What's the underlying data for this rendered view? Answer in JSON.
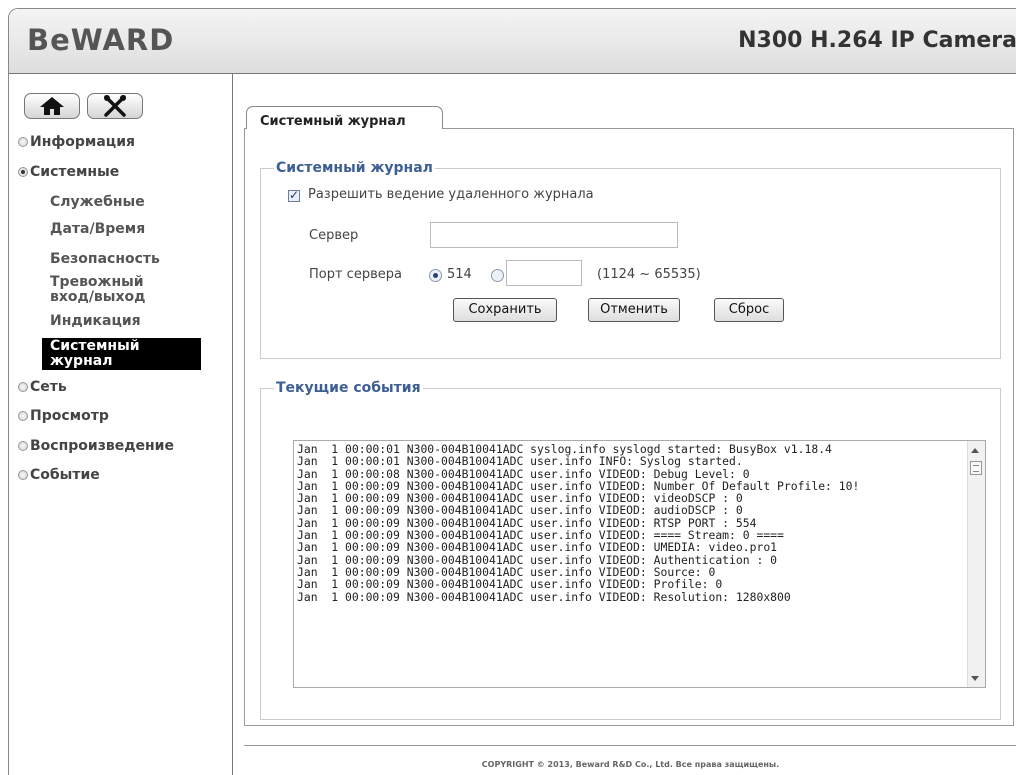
{
  "header": {
    "logo": "BeWARD",
    "model": "N300 H.264 IP Camera"
  },
  "nav_buttons": [
    {
      "icon": "home-icon"
    },
    {
      "icon": "tools-icon"
    }
  ],
  "menu": {
    "info": "Информация",
    "system": "Системные",
    "system_items": {
      "service": "Служебные",
      "datetime": "Дата/Время",
      "security": "Безопасность",
      "alarm_io_1": "Тревожный",
      "alarm_io_2": "вход/выход",
      "indication": "Индикация",
      "syslog_1": "Системный",
      "syslog_2": "журнал"
    },
    "network": "Сеть",
    "view": "Просмотр",
    "playback": "Воспроизведение",
    "event": "Событие"
  },
  "tab": {
    "label": "Системный журнал"
  },
  "syslog": {
    "legend": "Системный журнал",
    "remote_checkbox_label": "Разрешить ведение удаленного журнала",
    "remote_enabled": true,
    "server_label": "Сервер",
    "server_value": "",
    "port_label": "Порт сервера",
    "port_default": "514",
    "port_custom_value": "",
    "port_range": "(1124 ~ 65535)",
    "save": "Сохранить",
    "cancel": "Отменить",
    "reset": "Сброс"
  },
  "events": {
    "legend": "Текущие события",
    "log": "Jan  1 00:00:01 N300-004B10041ADC syslog.info syslogd started: BusyBox v1.18.4\nJan  1 00:00:01 N300-004B10041ADC user.info INFO: Syslog started.\nJan  1 00:00:08 N300-004B10041ADC user.info VIDEOD: Debug Level: 0\nJan  1 00:00:09 N300-004B10041ADC user.info VIDEOD: Number Of Default Profile: 10!\nJan  1 00:00:09 N300-004B10041ADC user.info VIDEOD: videoDSCP : 0\nJan  1 00:00:09 N300-004B10041ADC user.info VIDEOD: audioDSCP : 0\nJan  1 00:00:09 N300-004B10041ADC user.info VIDEOD: RTSP PORT : 554\nJan  1 00:00:09 N300-004B10041ADC user.info VIDEOD: ==== Stream: 0 ====\nJan  1 00:00:09 N300-004B10041ADC user.info VIDEOD: UMEDIA: video.pro1\nJan  1 00:00:09 N300-004B10041ADC user.info VIDEOD: Authentication : 0\nJan  1 00:00:09 N300-004B10041ADC user.info VIDEOD: Source: 0\nJan  1 00:00:09 N300-004B10041ADC user.info VIDEOD: Profile: 0\nJan  1 00:00:09 N300-004B10041ADC user.info VIDEOD: Resolution: 1280x800"
  },
  "footer": "COPYRIGHT © 2013, Beward R&D Co., Ltd. Все права защищены."
}
